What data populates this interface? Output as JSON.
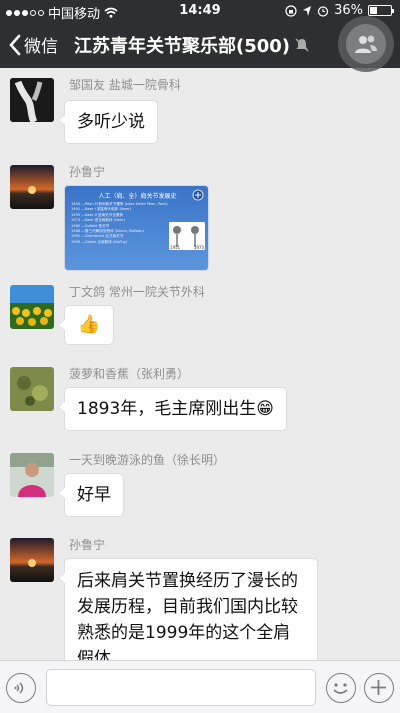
{
  "status_bar": {
    "carrier": "中国移动",
    "time": "14:49",
    "battery_text": "36%",
    "battery_level": 0.36
  },
  "nav": {
    "back_label": "微信",
    "title": "江苏青年关节聚乐部(500)"
  },
  "messages": [
    {
      "sender": "邹国友 盐城一院骨科",
      "type": "text",
      "text": "多听少说"
    },
    {
      "sender": "孙鲁宁",
      "type": "image"
    },
    {
      "sender": "丁文鸽 常州一院关节外科",
      "type": "emoji",
      "emoji": "👍"
    },
    {
      "sender": "菠萝和香蕉（张利勇）",
      "type": "text",
      "text": "1893年，毛主席刚出生",
      "emoji": "😁"
    },
    {
      "sender": "一天到晚游泳的鱼（徐长明）",
      "type": "text",
      "text": "好早"
    },
    {
      "sender": "孙鲁宁",
      "type": "text",
      "text": "后来肩关节置换经历了漫长的发展历程，目前我们国内比较熟悉的是1999年的这个全肩假体"
    }
  ],
  "slide": {
    "title": "人工（肩、全）肩关节发展史",
    "rows": [
      "1893 —Péan 行首例肩关节置换 (Jules Emile Péan, Paris)",
      "1951 —Neer I 型肱骨头假体 (Neer)",
      "1955 —Neer II 型肩关节全置换",
      "1973 —Neer 型全肩假体 (Neer)",
      "1985 —Cofield 型关节",
      "1988 —第三代解剖型假体 (Walch, Boileau)",
      "1991 —Grammont 反式肩关节",
      "1999 —Global 全肩假体 (DePuy)"
    ],
    "labels": [
      "1951",
      "1973"
    ]
  },
  "input_bar": {
    "voice_icon": "voice-icon",
    "emoji_icon": "emoji-icon",
    "plus_icon": "plus-icon"
  }
}
